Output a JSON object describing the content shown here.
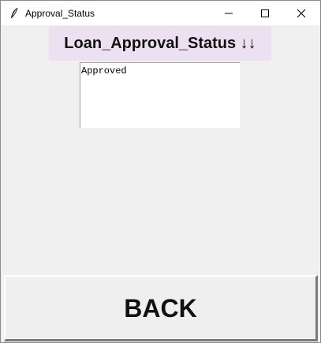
{
  "window": {
    "title": "Approval_Status",
    "app_icon": "feather-icon",
    "controls": {
      "minimize_icon": "minimize-icon",
      "maximize_icon": "maximize-icon",
      "close_icon": "close-icon"
    }
  },
  "heading": {
    "label": "Loan_Approval_Status ↓↓",
    "background": "#ece1f0"
  },
  "status_box": {
    "value": "Approved"
  },
  "back_button": {
    "label": "BACK"
  }
}
